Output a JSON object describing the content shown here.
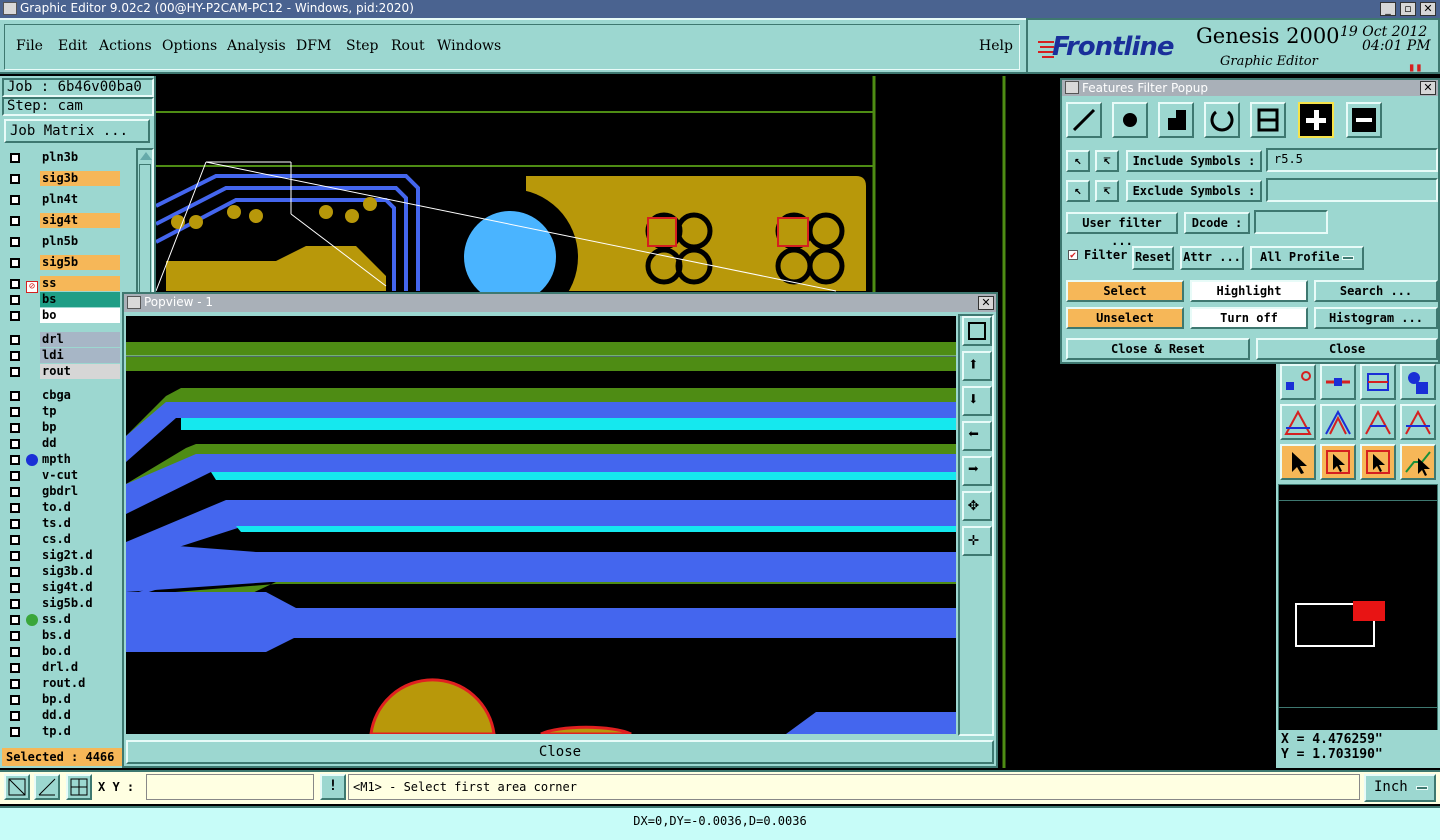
{
  "window_title": "Graphic Editor 9.02c2 (00@HY-P2CAM-PC12 - Windows, pid:2020)",
  "menu": [
    "File",
    "Edit",
    "Actions",
    "Options",
    "Analysis",
    "DFM",
    "Step",
    "Rout",
    "Windows"
  ],
  "help_label": "Help",
  "brand": {
    "logo": "Frontline",
    "product": "Genesis 2000",
    "date": "19 Oct 2012",
    "time": "04:01 PM",
    "subtitle": "Graphic Editor"
  },
  "job": {
    "job_label": "Job : 6b46v00ba0",
    "step_label": "Step: cam",
    "matrix_button": "Job Matrix ..."
  },
  "layers": [
    {
      "name": "pln3b",
      "color": "#9cd7d0"
    },
    {
      "name": "sig3b",
      "color": "#f6b758"
    },
    {
      "name": "pln4t",
      "color": "#9cd7d0"
    },
    {
      "name": "sig4t",
      "color": "#f6b758"
    },
    {
      "name": "pln5b",
      "color": "#9cd7d0"
    },
    {
      "name": "sig5b",
      "color": "#f6b758"
    },
    {
      "name": "ss",
      "color": "#f6b758"
    },
    {
      "name": "bs",
      "color": "#1f9e86"
    },
    {
      "name": "bo",
      "color": "#ffffff"
    },
    {
      "name": "drl",
      "color": "#a7b6c6"
    },
    {
      "name": "ldi",
      "color": "#a7b6c6"
    },
    {
      "name": "rout",
      "color": "#d6d6d6"
    },
    {
      "name": "cbga",
      "color": "#9cd7d0"
    },
    {
      "name": "tp",
      "color": "#9cd7d0"
    },
    {
      "name": "bp",
      "color": "#9cd7d0"
    },
    {
      "name": "dd",
      "color": "#9cd7d0"
    },
    {
      "name": "mpth",
      "color": "#9cd7d0"
    },
    {
      "name": "v-cut",
      "color": "#9cd7d0"
    },
    {
      "name": "gbdrl",
      "color": "#9cd7d0"
    },
    {
      "name": "to.d",
      "color": "#9cd7d0"
    },
    {
      "name": "ts.d",
      "color": "#9cd7d0"
    },
    {
      "name": "cs.d",
      "color": "#9cd7d0"
    },
    {
      "name": "sig2t.d",
      "color": "#9cd7d0"
    },
    {
      "name": "sig3b.d",
      "color": "#9cd7d0"
    },
    {
      "name": "sig4t.d",
      "color": "#9cd7d0"
    },
    {
      "name": "sig5b.d",
      "color": "#9cd7d0"
    },
    {
      "name": "ss.d",
      "color": "#9cd7d0"
    },
    {
      "name": "bs.d",
      "color": "#9cd7d0"
    },
    {
      "name": "bo.d",
      "color": "#9cd7d0"
    },
    {
      "name": "drl.d",
      "color": "#9cd7d0"
    },
    {
      "name": "rout.d",
      "color": "#9cd7d0"
    },
    {
      "name": "bp.d",
      "color": "#9cd7d0"
    },
    {
      "name": "dd.d",
      "color": "#9cd7d0"
    },
    {
      "name": "tp.d",
      "color": "#9cd7d0"
    }
  ],
  "selected_label": "Selected : 4466",
  "popview": {
    "title": "Popview - 1",
    "close_label": "Close"
  },
  "filter": {
    "title": "Features Filter Popup",
    "include_label": "Include Symbols :",
    "include_value": "r5.5",
    "exclude_label": "Exclude Symbols :",
    "exclude_value": "",
    "user_filter": "User filter ...",
    "dcode_label": "Dcode :",
    "dcode_value": "",
    "filter_label": "Filter",
    "reset": "Reset",
    "attr": "Attr ...",
    "profile": "All Profile",
    "select": "Select",
    "highlight": "Highlight",
    "search": "Search ...",
    "unselect": "Unselect",
    "turn_off": "Turn off",
    "histogram": "Histogram ...",
    "close_reset": "Close & Reset",
    "close": "Close"
  },
  "coords": {
    "x": "X = 4.476259\"",
    "y": "Y = 1.703190\""
  },
  "xy_label": "X Y :",
  "xy_value": "",
  "prompt": "<M1> - Select first area corner",
  "units": "Inch",
  "status": "DX=0,DY=-0.0036,D=0.0036",
  "colors": {
    "teal": "#9cd7d0",
    "orange": "#f6b758",
    "title_blue": "#46608e",
    "trace_blue": "#4466ee",
    "cyan": "#15e8ee",
    "green": "#4e8c14",
    "copper": "#b8980a"
  }
}
